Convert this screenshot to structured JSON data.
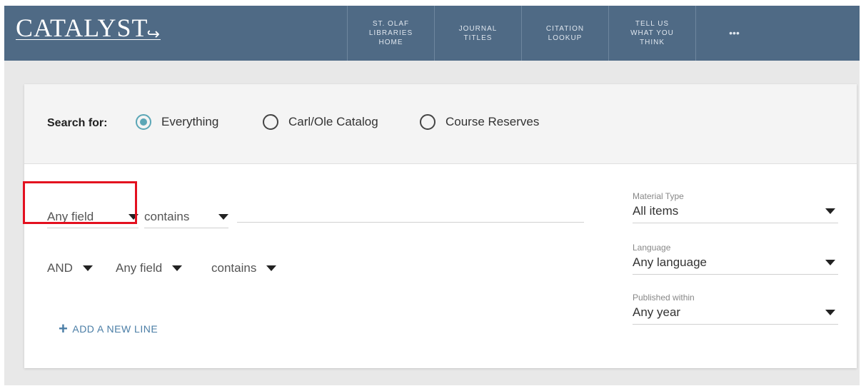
{
  "header": {
    "logo": "CATALYST",
    "nav": [
      {
        "label": "ST. OLAF\nLIBRARIES\nHOME"
      },
      {
        "label": "JOURNAL\nTITLES"
      },
      {
        "label": "CITATION\nLOOKUP"
      },
      {
        "label": "TELL US\nWHAT YOU\nTHINK"
      },
      {
        "label": "•••"
      }
    ]
  },
  "search": {
    "search_for_label": "Search for:",
    "scopes": [
      {
        "label": "Everything",
        "checked": true
      },
      {
        "label": "Carl/Ole Catalog",
        "checked": false
      },
      {
        "label": "Course Reserves",
        "checked": false
      }
    ],
    "line1": {
      "field": "Any field",
      "operator": "contains",
      "value": ""
    },
    "line2": {
      "boolean": "AND",
      "field": "Any field",
      "operator": "contains"
    },
    "add_line_label": "ADD A NEW LINE"
  },
  "facets": [
    {
      "title": "Material Type",
      "value": "All items"
    },
    {
      "title": "Language",
      "value": "Any language"
    },
    {
      "title": "Published within",
      "value": "Any year"
    }
  ]
}
